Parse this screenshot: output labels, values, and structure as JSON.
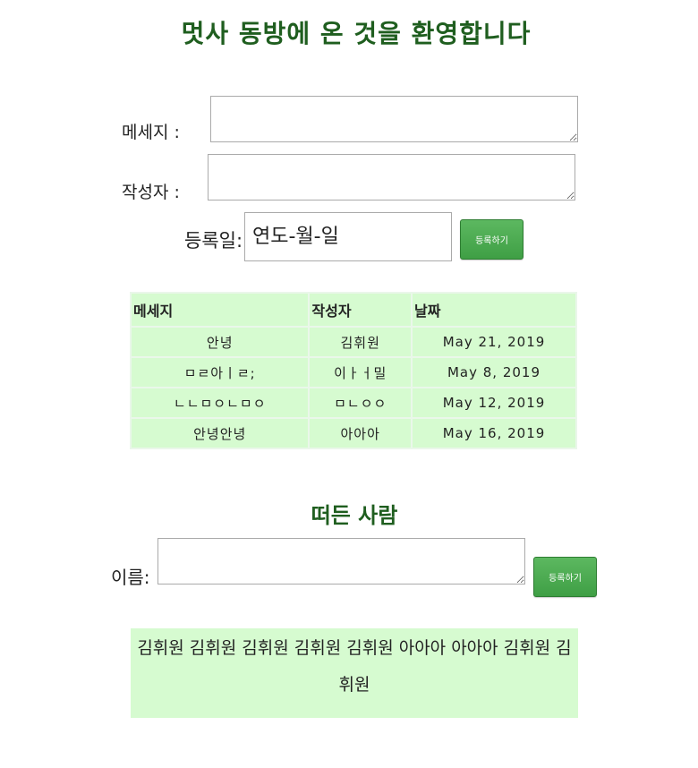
{
  "header": {
    "title": "멋사 동방에 온 것을 환영합니다"
  },
  "message_form": {
    "message_label": "메세지 :",
    "author_label": "작성자 :",
    "date_label": "등록일:",
    "date_placeholder": "연도-월-일",
    "submit_label": "등록하기"
  },
  "messages_table": {
    "headers": [
      "메세지",
      "작성자",
      "날짜"
    ],
    "rows": [
      {
        "message": "안녕",
        "author": "김휘원",
        "date": "May 21, 2019"
      },
      {
        "message": "ㅁㄹ아ㅣㄹ;",
        "author": "이ㅏㅓ밀",
        "date": "May 8, 2019"
      },
      {
        "message": "ㄴㄴㅁㅇㄴㅁㅇ",
        "author": "ㅁㄴㅇㅇ",
        "date": "May 12, 2019"
      },
      {
        "message": "안녕안녕",
        "author": "아아아",
        "date": "May 16, 2019"
      }
    ]
  },
  "noisy_section": {
    "title": "떠든 사람",
    "name_label": "이름:",
    "submit_label": "등록하기",
    "names_text": "김휘원 김휘원 김휘원 김휘원 김휘원 아아아 아아아 김휘원 김휘원"
  }
}
